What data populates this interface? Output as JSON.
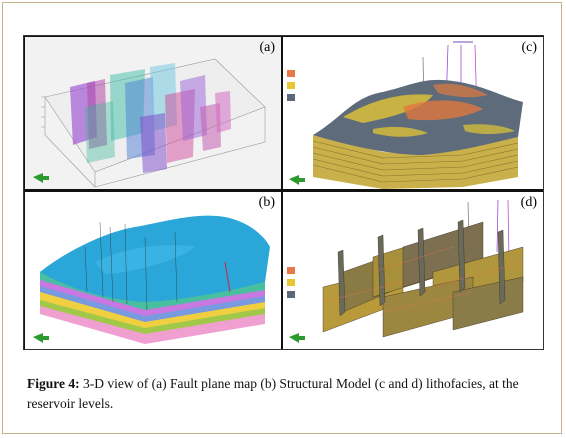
{
  "figure": {
    "panels": [
      {
        "label": "(a)"
      },
      {
        "label": "(c)"
      },
      {
        "label": "(b)"
      },
      {
        "label": "(d)"
      }
    ],
    "caption": {
      "label": "Figure 4:",
      "text": "3-D view of (a) Fault plane map (b) Structural Model (c and d) lithofacies, at the reservoir levels."
    },
    "colors": {
      "border": "#c9b38a",
      "sand": "#e8774a",
      "shale": "#e8c832",
      "mudstone": "#5a6878",
      "structure_blue": "#2aa6d8"
    }
  }
}
